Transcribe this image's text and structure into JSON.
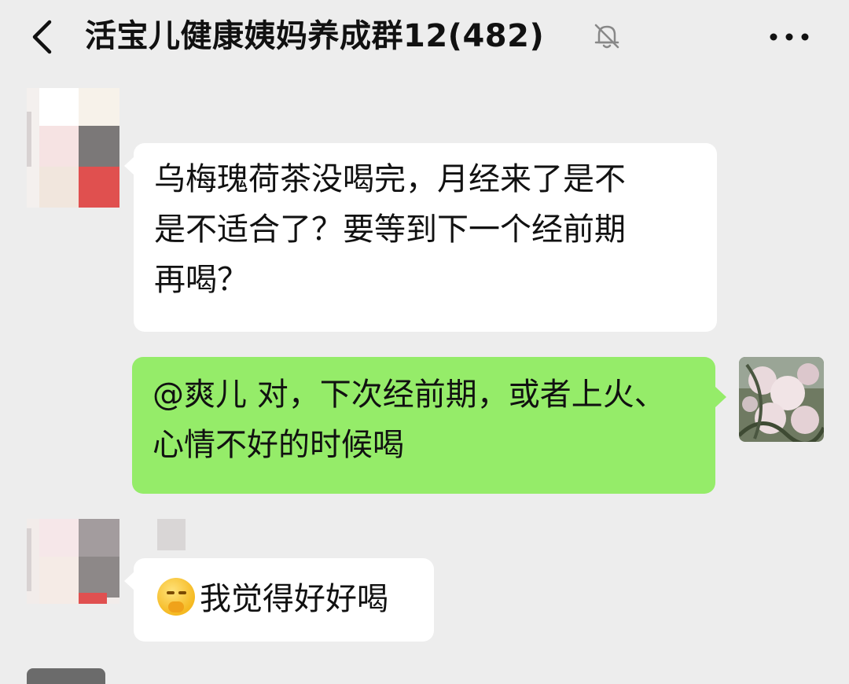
{
  "header": {
    "title": "活宝儿健康姨妈养成群12(482)",
    "back_icon": "chevron-left-icon",
    "mute_icon": "bell-off-icon",
    "more_icon": "more-icon"
  },
  "messages": [
    {
      "side": "left",
      "lines": [
        "乌梅瑰荷茶没喝完，月经来了是不",
        "是不适合了？要等到下一个经前期",
        "再喝？"
      ]
    },
    {
      "side": "right",
      "lines": [
        "@爽儿  对，下次经前期，或者上火、",
        "心情不好的时候喝"
      ]
    },
    {
      "side": "left",
      "emoji": "hand-over-mouth-emoji",
      "lines": [
        "我觉得好好喝"
      ]
    }
  ],
  "colors": {
    "background": "#ededed",
    "bubble_incoming": "#ffffff",
    "bubble_outgoing": "#95ec69"
  }
}
